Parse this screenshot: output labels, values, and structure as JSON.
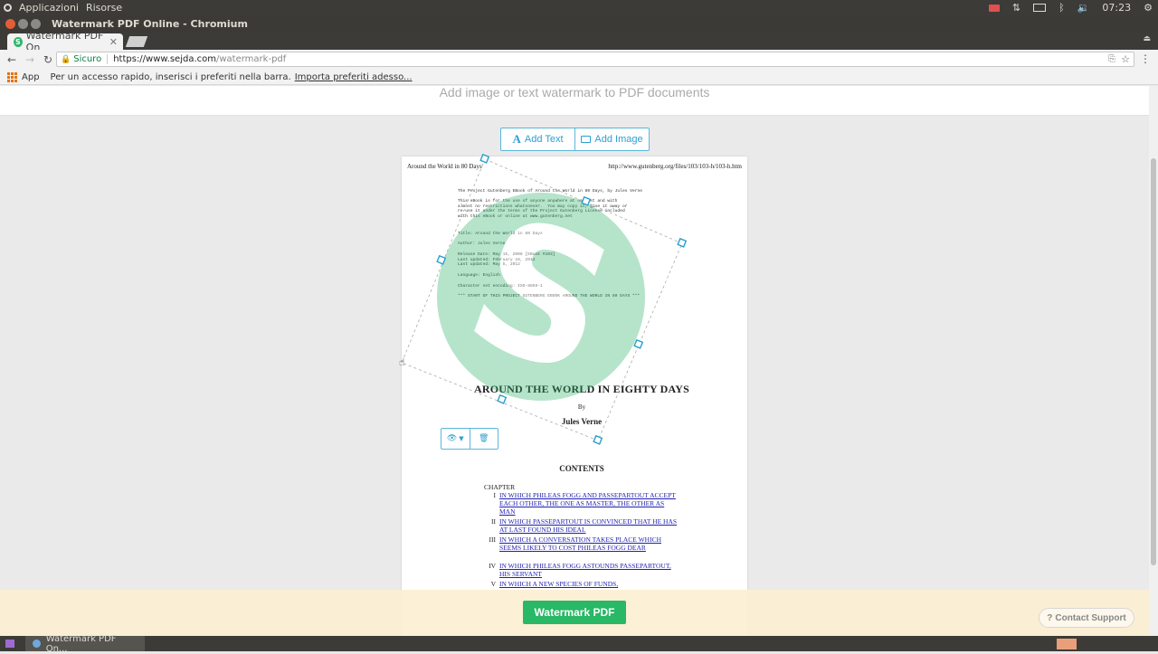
{
  "os_panel": {
    "menu": [
      "Applicazioni",
      "Risorse"
    ],
    "clock": "07:23"
  },
  "window": {
    "title": "Watermark PDF Online - Chromium"
  },
  "tab": {
    "label": "Watermark PDF On",
    "favicon": "S"
  },
  "toolbar": {
    "secure_label": "Sicuro",
    "url_host": "https://www.sejda.com",
    "url_path": "/watermark-pdf"
  },
  "bookmarks": {
    "apps_label": "App",
    "hint": "Per un accesso rapido, inserisci i preferiti nella barra.",
    "import_link": "Importa preferiti adesso..."
  },
  "page": {
    "subtitle": "Add image or text watermark to PDF documents",
    "add_text_label": "Add Text",
    "add_image_label": "Add Image",
    "submit_label": "Watermark PDF",
    "contact_label": "Contact Support"
  },
  "pdf": {
    "header_left": "Around the World in 80 Days",
    "header_right": "http://www.gutenberg.org/files/103/103-h/103-h.htm",
    "mono_lines": [
      "The Project Gutenberg EBook of Around the World in 80 Days, by Jules Verne",
      "This eBook is for the use of anyone anywhere at no cost and with\nalmost no restrictions whatsoever.  You may copy it, give it away or\nre-use it under the terms of the Project Gutenberg License included\nwith this eBook or online at www.gutenberg.net",
      "Title: Around the World in 80 Days",
      "Author: Jules Verne",
      "Release Date: May 15, 2008 [EBook #103]\nLast updated: February 18, 2012\nLast updated: May 5, 2012",
      "Language: English",
      "Character set encoding: ISO-8859-1",
      "*** START OF THIS PROJECT GUTENBERG EBOOK AROUND THE WORLD IN 80 DAYS ***"
    ],
    "title": "AROUND THE WORLD IN EIGHTY DAYS",
    "by": "By",
    "author": "Jules Verne",
    "contents": "CONTENTS",
    "chapter": "CHAPTER",
    "toc": [
      {
        "num": "I",
        "text": "IN WHICH PHILEAS FOGG AND PASSEPARTOUT ACCEPT EACH OTHER, THE ONE AS MASTER, THE OTHER AS MAN"
      },
      {
        "num": "II",
        "text": "IN WHICH PASSEPARTOUT IS CONVINCED THAT HE HAS AT LAST FOUND HIS IDEAL"
      },
      {
        "num": "III",
        "text": "IN WHICH A CONVERSATION TAKES PLACE WHICH SEEMS LIKELY TO COST PHILEAS FOGG DEAR"
      },
      {
        "num": "IV",
        "text": "IN WHICH PHILEAS FOGG ASTOUNDS PASSEPARTOUT, HIS SERVANT"
      },
      {
        "num": "V",
        "text": "IN WHICH A NEW SPECIES OF FUNDS,"
      }
    ]
  },
  "watermark": {
    "glyph": "S",
    "color": "#2db469"
  },
  "taskbar": {
    "item_label": "Watermark PDF On..."
  },
  "colors": {
    "accent": "#2aa0d0",
    "submit": "#28b866",
    "panel": "#3c3b37"
  }
}
